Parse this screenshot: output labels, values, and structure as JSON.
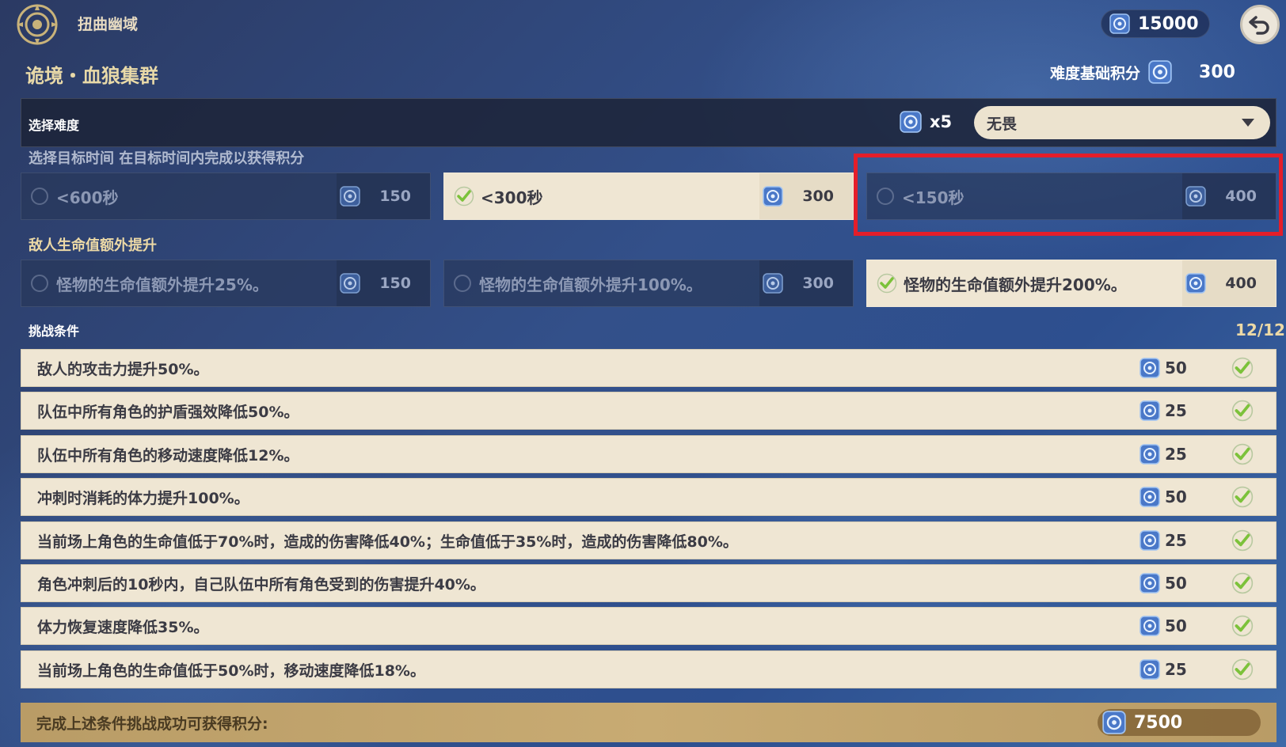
{
  "header": {
    "domain_title": "扭曲幽域",
    "currency_value": "15000"
  },
  "stage": {
    "title": "诡境・血狼集群",
    "base_score_label": "难度基础积分",
    "base_score_value": "300"
  },
  "difficulty": {
    "label": "选择难度",
    "multiplier": "x5",
    "selected": "无畏"
  },
  "time_target": {
    "label": "选择目标时间 在目标时间内完成以获得积分",
    "options": [
      {
        "label": "<600秒",
        "points": "150",
        "selected": false
      },
      {
        "label": "<300秒",
        "points": "300",
        "selected": true
      },
      {
        "label": "<150秒",
        "points": "400",
        "selected": false
      }
    ]
  },
  "enemy_hp": {
    "label": "敌人生命值额外提升",
    "options": [
      {
        "label": "怪物的生命值额外提升25%。",
        "points": "150",
        "selected": false
      },
      {
        "label": "怪物的生命值额外提升100%。",
        "points": "300",
        "selected": false
      },
      {
        "label": "怪物的生命值额外提升200%。",
        "points": "400",
        "selected": true
      }
    ]
  },
  "conditions": {
    "label": "挑战条件",
    "count": "12/12",
    "items": [
      {
        "text": "敌人的攻击力提升50%。",
        "points": "50"
      },
      {
        "text": "队伍中所有角色的护盾强效降低50%。",
        "points": "25"
      },
      {
        "text": "队伍中所有角色的移动速度降低12%。",
        "points": "25"
      },
      {
        "text": "冲刺时消耗的体力提升100%。",
        "points": "50"
      },
      {
        "text": "当前场上角色的生命值低于70%时，造成的伤害降低40%；生命值低于35%时，造成的伤害降低80%。",
        "points": "25"
      },
      {
        "text": "角色冲刺后的10秒内，自己队伍中所有角色受到的伤害提升40%。",
        "points": "50"
      },
      {
        "text": "体力恢复速度降低35%。",
        "points": "50"
      },
      {
        "text": "当前场上角色的生命值低于50%时，移动速度降低18%。",
        "points": "25"
      }
    ]
  },
  "footer": {
    "text": "完成上述条件挑战成功可获得积分:",
    "total": "7500"
  },
  "colors": {
    "highlight": "#e41e2a",
    "card_selected": "#efe6d3",
    "check_green": "#7cc23a"
  }
}
